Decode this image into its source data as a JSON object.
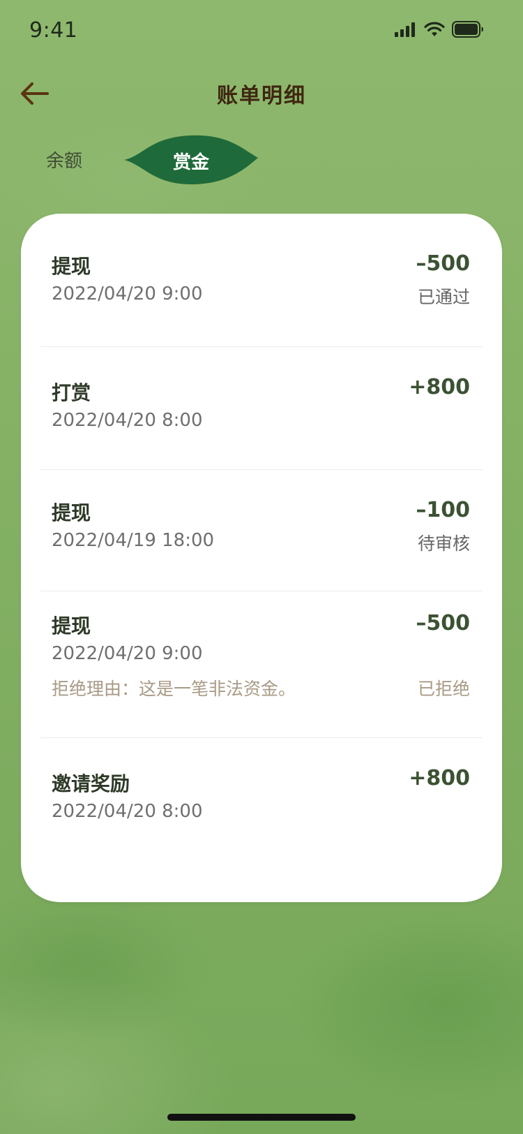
{
  "status_bar": {
    "time": "9:41",
    "icons": [
      "cellular-signal-icon",
      "wifi-icon",
      "battery-icon"
    ]
  },
  "header": {
    "back_icon": "arrow-left-icon",
    "title": "账单明细"
  },
  "tabs": [
    {
      "label": "余额",
      "active": false
    },
    {
      "label": "赏金",
      "active": true
    }
  ],
  "records": [
    {
      "title": "提现",
      "time": "2022/04/20 9:00",
      "amount": "–500",
      "status": "已通过"
    },
    {
      "title": "打赏",
      "time": "2022/04/20 8:00",
      "amount": "+800",
      "status": ""
    },
    {
      "title": "提现",
      "time": "2022/04/19 18:00",
      "amount": "–100",
      "status": "待审核"
    },
    {
      "title": "提现",
      "time": "2022/04/20 9:00",
      "amount": "–500",
      "status": "已拒绝",
      "reason": "拒绝理由：这是一笔非法资金。"
    },
    {
      "title": "邀请奖励",
      "time": "2022/04/20 8:00",
      "amount": "+800",
      "status": ""
    }
  ],
  "colors": {
    "background_green": "#84b164",
    "active_tab_green": "#1f6a3a",
    "title_brown": "#3e2710",
    "amount_green": "#3b5233"
  }
}
